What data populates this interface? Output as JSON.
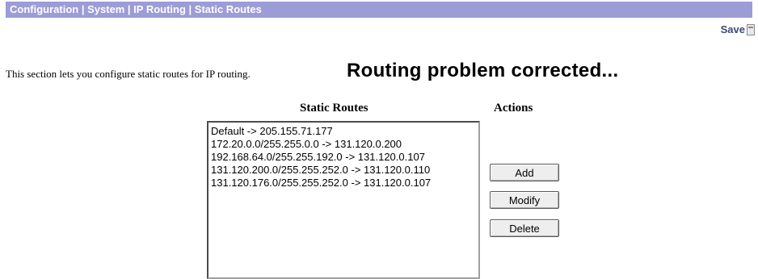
{
  "breadcrumb": "Configuration | System | IP Routing | Static Routes",
  "save": {
    "label": "Save"
  },
  "intro_text": "This section lets you configure static routes for IP routing.",
  "headline": "Routing problem corrected...",
  "table": {
    "routes_header": "Static Routes",
    "actions_header": "Actions"
  },
  "routes": [
    "Default -> 205.155.71.177",
    "172.20.0.0/255.255.0.0 -> 131.120.0.200",
    "192.168.64.0/255.255.192.0 -> 131.120.0.107",
    "131.120.200.0/255.255.252.0 -> 131.120.0.110",
    "131.120.176.0/255.255.252.0 -> 131.120.0.107"
  ],
  "actions": {
    "add": "Add",
    "modify": "Modify",
    "delete": "Delete"
  },
  "colors": {
    "breadcrumb_bar": "#9c9cd6",
    "breadcrumb_text": "#ffffff",
    "save_text": "#3a4a7a"
  },
  "icons": {
    "save": "save-icon"
  }
}
